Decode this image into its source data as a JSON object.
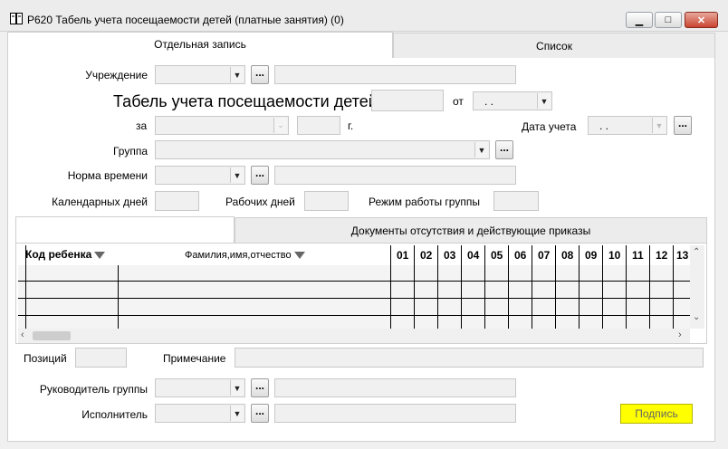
{
  "window": {
    "title": "P620 Табель учета посещаемости детей (платные занятия) (0)",
    "minimize_icon": "minimize-icon",
    "maximize_icon": "maximize-icon",
    "close_icon": "close-icon"
  },
  "tabs": {
    "single": "Отдельная запись",
    "list": "Список"
  },
  "form": {
    "institution_label": "Учреждение",
    "heading": "Табель учета посещаемости детей №",
    "from_label": "от",
    "date_value": ". .",
    "for_label": "за",
    "year_suffix": "г.",
    "accounting_date_label": "Дата учета",
    "accounting_date_value": ". .",
    "group_label": "Группа",
    "time_norm_label": "Норма времени",
    "calendar_days_label": "Календарных дней",
    "working_days_label": "Рабочих дней",
    "group_mode_label": "Режим работы группы",
    "dots_label": "..."
  },
  "inner_tabs": {
    "main": "",
    "absence": "Документы отсутствия и действующие приказы"
  },
  "grid": {
    "columns": [
      "Код ребенка",
      "Фамилия,имя,отчество",
      "01",
      "02",
      "03",
      "04",
      "05",
      "06",
      "07",
      "08",
      "09",
      "10",
      "11",
      "12",
      "13"
    ]
  },
  "footer": {
    "positions_label": "Позиций",
    "note_label": "Примечание",
    "group_head_label": "Руководитель группы",
    "executor_label": "Исполнитель",
    "sign_button": "Подпись"
  }
}
